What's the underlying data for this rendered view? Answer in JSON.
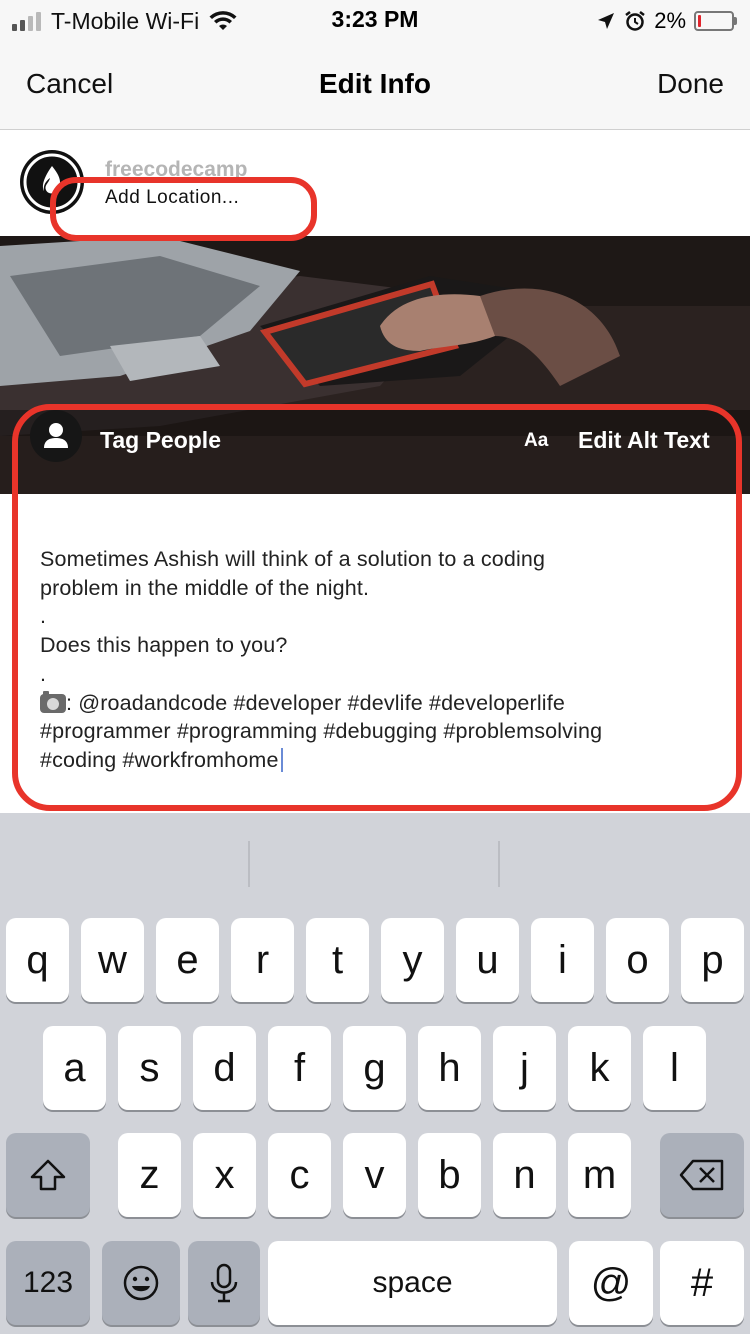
{
  "status_bar": {
    "carrier": "T-Mobile Wi-Fi",
    "time": "3:23 PM",
    "battery": "2%",
    "battery_level": 0.02
  },
  "nav": {
    "cancel": "Cancel",
    "title": "Edit Info",
    "done": "Done"
  },
  "post": {
    "username": "freecodecamp",
    "location": "Add Location...",
    "tag_people": "Tag People",
    "alt_text_icon": "Aa",
    "edit_alt_text": "Edit Alt Text"
  },
  "caption": {
    "lines": [
      "Sometimes Ashish will think of a solution to a coding",
      "problem in the middle of the night.",
      ".",
      "Does this happen to you?",
      ".",
      ": @roadandcode #developer #devlife #developerlife",
      "#programmer #programming #debugging #problemsolving",
      "#coding #workfromhome"
    ],
    "camera_emoji_icon": "camera-emoji-icon"
  },
  "keyboard": {
    "row1": [
      "q",
      "w",
      "e",
      "r",
      "t",
      "y",
      "u",
      "i",
      "o",
      "p"
    ],
    "row2": [
      "a",
      "s",
      "d",
      "f",
      "g",
      "h",
      "j",
      "k",
      "l"
    ],
    "row3": [
      "z",
      "x",
      "c",
      "v",
      "b",
      "n",
      "m"
    ],
    "numbers": "123",
    "space": "space",
    "at": "@",
    "hash": "#"
  },
  "colors": {
    "annotation": "#e8342a",
    "key_bg": "#ffffff",
    "keyboard_bg": "#d1d3d9",
    "cursor": "#6a8bd6"
  }
}
